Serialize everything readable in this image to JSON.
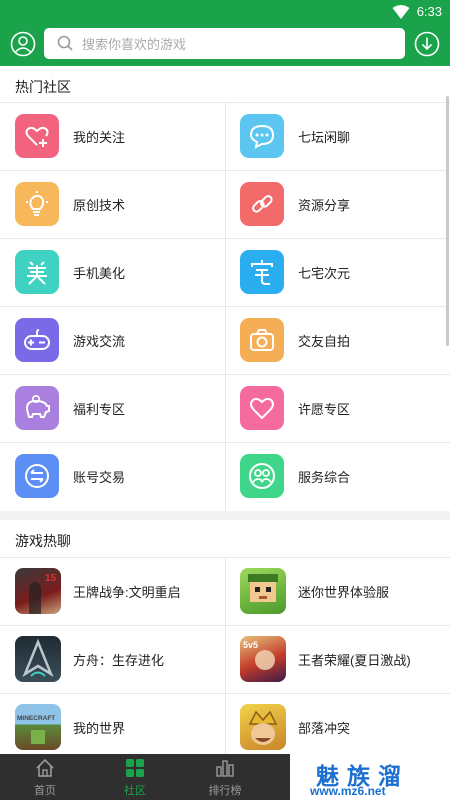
{
  "status_bar": {
    "time": "6:33"
  },
  "search": {
    "placeholder": "搜索你喜欢的游戏"
  },
  "hot_community": {
    "title": "热门社区",
    "items": [
      {
        "label": "我的关注",
        "icon": "heart-plus-icon",
        "color": "#f1637e"
      },
      {
        "label": "七坛闲聊",
        "icon": "chat-bubble-icon",
        "color": "#5cc6f0"
      },
      {
        "label": "原创技术",
        "icon": "lightbulb-icon",
        "color": "#f7b85c"
      },
      {
        "label": "资源分享",
        "icon": "link-icon",
        "color": "#f26a6a"
      },
      {
        "label": "手机美化",
        "icon": "beautify-icon",
        "color": "#3fd2c3"
      },
      {
        "label": "七宅次元",
        "icon": "otaku-icon",
        "color": "#2aaef0"
      },
      {
        "label": "游戏交流",
        "icon": "gamepad-icon",
        "color": "#7a6ae8"
      },
      {
        "label": "交友自拍",
        "icon": "camera-icon",
        "color": "#f5ae56"
      },
      {
        "label": "福利专区",
        "icon": "piggy-bank-icon",
        "color": "#a980e0"
      },
      {
        "label": "许愿专区",
        "icon": "heart-icon",
        "color": "#f56ba0"
      },
      {
        "label": "账号交易",
        "icon": "exchange-icon",
        "color": "#5b8ff5"
      },
      {
        "label": "服务综合",
        "icon": "users-icon",
        "color": "#3fd68a"
      }
    ]
  },
  "game_chat": {
    "title": "游戏热聊",
    "items": [
      {
        "label": "王牌战争:文明重启",
        "icon": "game-wangpai-icon",
        "color": "#7a1c1c",
        "badge": "15"
      },
      {
        "label": "迷你世界体验服",
        "icon": "game-mini-world-icon",
        "color": "#6bbd3a"
      },
      {
        "label": "方舟：生存进化",
        "icon": "game-ark-icon",
        "color": "#2b3b45"
      },
      {
        "label": "王者荣耀(夏日激战)",
        "icon": "game-honor-of-kings-icon",
        "color": "#c23b2a",
        "badge": "5v5"
      },
      {
        "label": "我的世界",
        "icon": "game-minecraft-icon",
        "color": "#5a8a3a",
        "badge": "MINECRAFT"
      },
      {
        "label": "部落冲突",
        "icon": "game-clash-of-clans-icon",
        "color": "#d9a830"
      }
    ]
  },
  "tabs": [
    {
      "label": "首页",
      "icon": "home-icon",
      "active": false
    },
    {
      "label": "社区",
      "icon": "grid-icon",
      "active": true
    },
    {
      "label": "排行榜",
      "icon": "ranking-icon",
      "active": false
    }
  ],
  "watermark": {
    "cn": "魅族溜",
    "url": "www.mz6.net"
  },
  "colors": {
    "brand": "#1aa34a",
    "tabbar": "#2f2f2f",
    "watermark": "#1a6fd1"
  }
}
